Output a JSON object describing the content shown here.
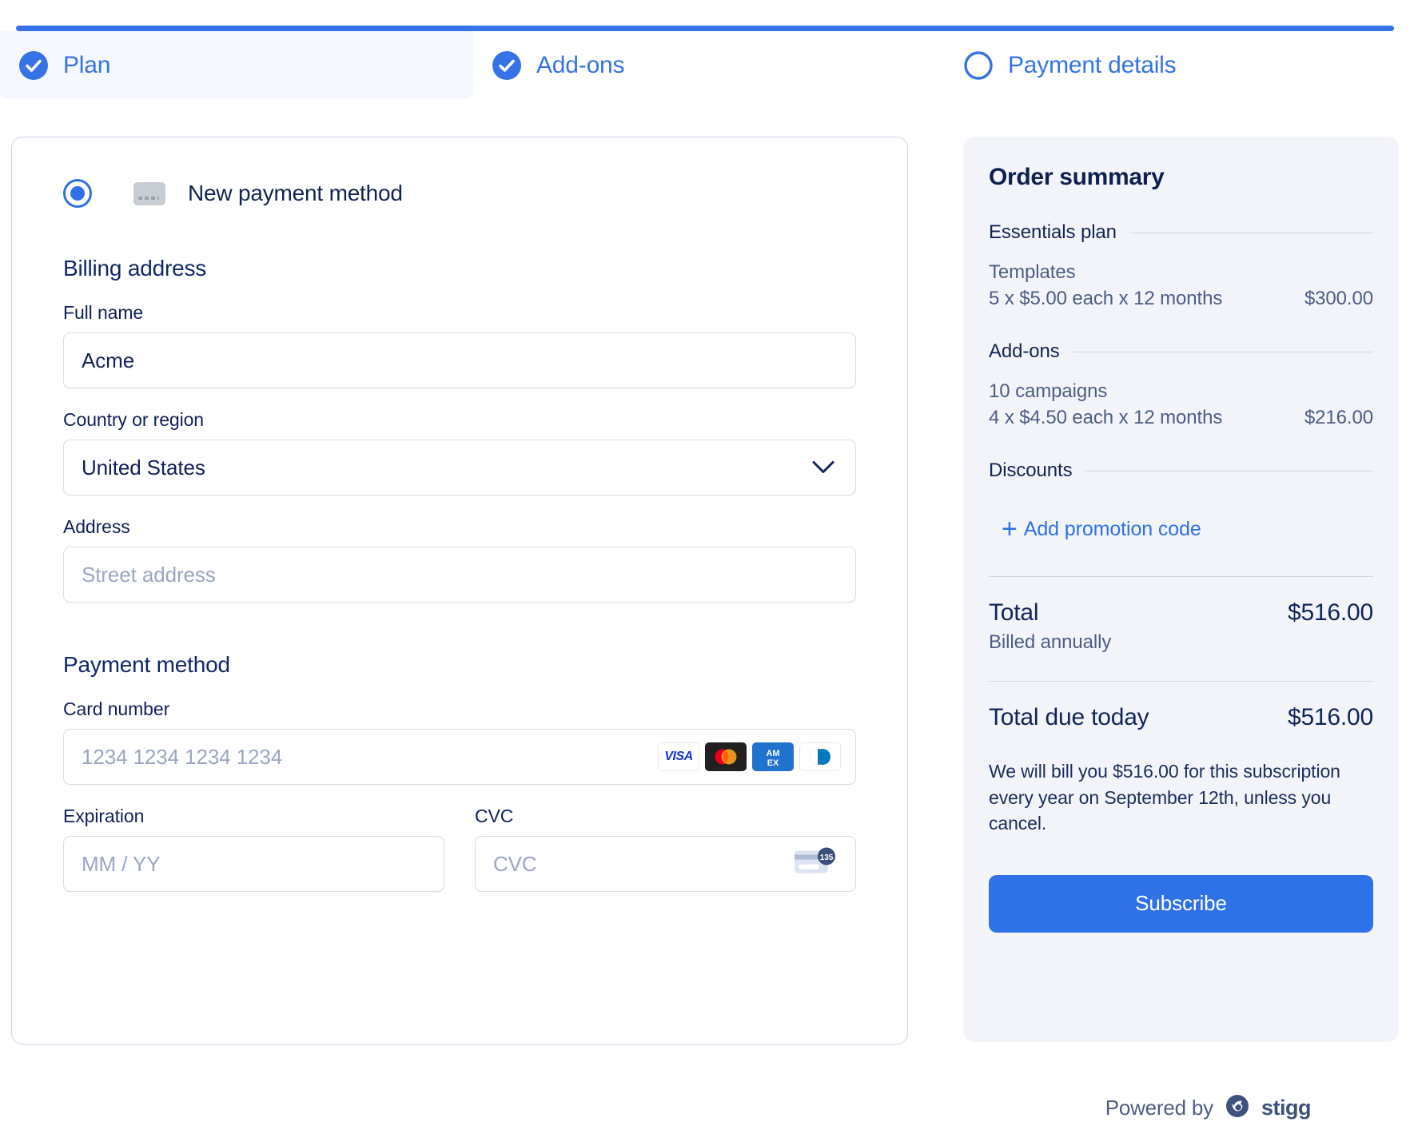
{
  "stepper": {
    "steps": [
      {
        "label": "Plan",
        "icon": "check-circle-icon",
        "state": "complete",
        "active": true
      },
      {
        "label": "Add-ons",
        "icon": "check-circle-icon",
        "state": "complete",
        "active": false
      },
      {
        "label": "Payment details",
        "icon": "empty-circle-icon",
        "state": "current",
        "active": false
      }
    ]
  },
  "payment_form": {
    "method_option": {
      "label": "New payment method",
      "selected": true,
      "icon": "credit-card-icon"
    },
    "billing_address": {
      "heading": "Billing address",
      "full_name": {
        "label": "Full name",
        "value": "Acme",
        "placeholder": ""
      },
      "country": {
        "label": "Country or region",
        "value": "United States",
        "chevron": "chevron-down-icon"
      },
      "address": {
        "label": "Address",
        "value": "",
        "placeholder": "Street address"
      }
    },
    "payment_method": {
      "heading": "Payment method",
      "card_number": {
        "label": "Card number",
        "value": "",
        "placeholder": "1234 1234 1234 1234",
        "brands": [
          "visa-icon",
          "mastercard-icon",
          "amex-icon",
          "diners-club-icon"
        ],
        "brand_labels": [
          "VISA",
          "",
          "AMEX",
          ""
        ]
      },
      "expiration": {
        "label": "Expiration",
        "value": "",
        "placeholder": "MM / YY"
      },
      "cvc": {
        "label": "CVC",
        "value": "",
        "placeholder": "CVC",
        "icon": "cvc-card-icon",
        "icon_digits": "135"
      }
    }
  },
  "order_summary": {
    "title": "Order summary",
    "groups": [
      {
        "label": "Essentials plan",
        "items": [
          {
            "name": "Templates",
            "detail": "5 x $5.00 each x 12 months",
            "amount": "$300.00"
          }
        ]
      },
      {
        "label": "Add-ons",
        "items": [
          {
            "name": "10 campaigns",
            "detail": "4 x $4.50 each x 12 months",
            "amount": "$216.00"
          }
        ]
      },
      {
        "label": "Discounts",
        "items": []
      }
    ],
    "promo_link": "Add promotion code",
    "promo_icon": "plus-icon",
    "total": {
      "label": "Total",
      "amount": "$516.00",
      "sub": "Billed annually"
    },
    "total_due": {
      "label": "Total due today",
      "amount": "$516.00"
    },
    "billing_note": "We will bill you $516.00 for this subscription every year on September 12th, unless you cancel.",
    "subscribe_label": "Subscribe"
  },
  "footer": {
    "powered_by": "Powered by",
    "brand": "stigg",
    "logo_icon": "stigg-logo-icon"
  },
  "colors": {
    "accent_blue": "#2F72E8",
    "bar_blue": "#3573E6",
    "tab_active_bg": "#F5F8FE",
    "navy_text": "#11255B",
    "muted_text": "#4D5D86",
    "placeholder": "#9AA6C2",
    "panel_bg": "#F2F4F9",
    "border": "#D7DEE8"
  }
}
